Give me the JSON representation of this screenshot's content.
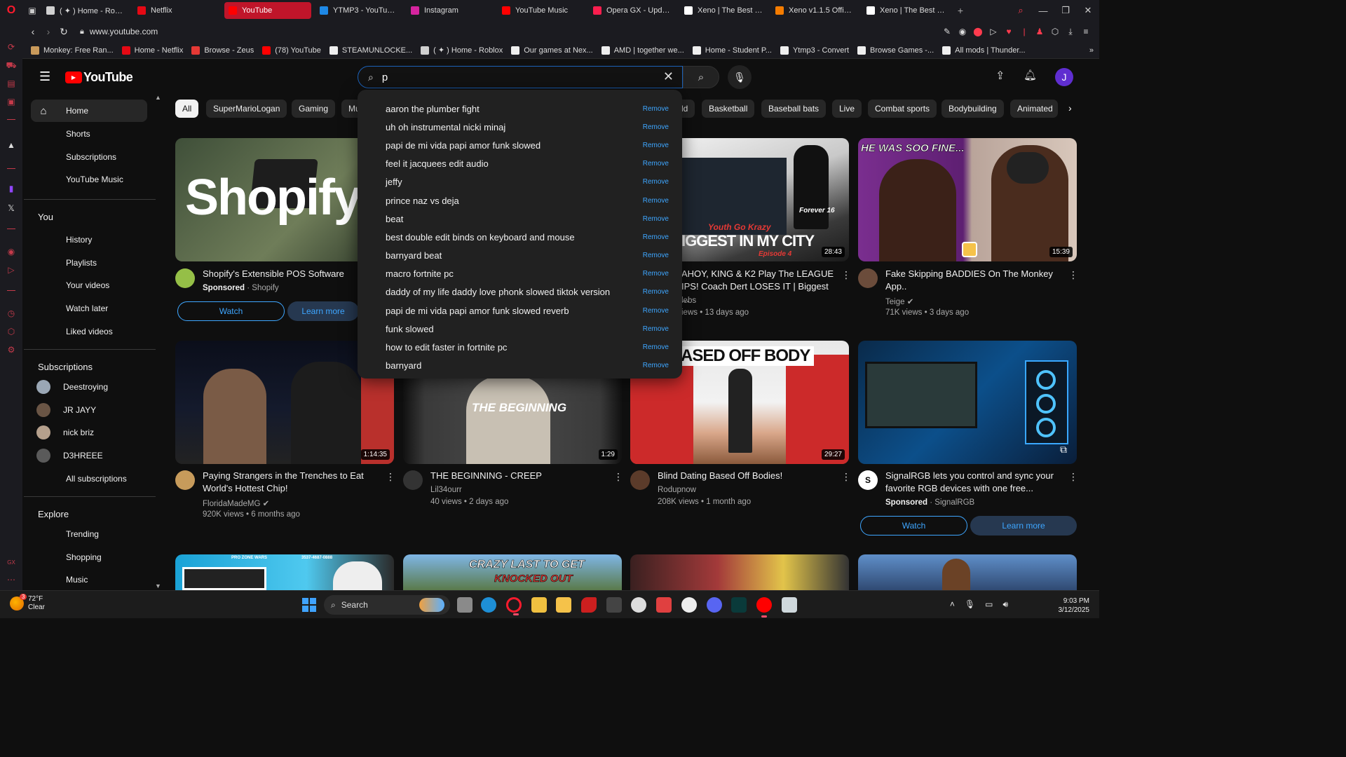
{
  "browser": {
    "tabs": [
      {
        "label": "( ✦ ) Home - Roblox",
        "color": "#d0d0d0",
        "active": false
      },
      {
        "label": "Netflix",
        "color": "#e50914",
        "active": false
      },
      {
        "label": "YouTube",
        "color": "#ff0000",
        "active": true
      },
      {
        "label": "YTMP3 - YouTube to",
        "color": "#1e88e5",
        "active": false
      },
      {
        "label": "Instagram",
        "color": "#d6249f",
        "active": false
      },
      {
        "label": "YouTube Music",
        "color": "#ff0000",
        "active": false
      },
      {
        "label": "Opera GX - Update c",
        "color": "#fa1e4e",
        "active": false
      },
      {
        "label": "Xeno | The Best Scri",
        "color": "#ffffff",
        "active": false
      },
      {
        "label": "Xeno v1.1.5 Official D",
        "color": "#f57c00",
        "active": false
      },
      {
        "label": "Xeno | The Best Scri",
        "color": "#ffffff",
        "active": false
      }
    ],
    "new_tab": "+",
    "url": "www.youtube.com",
    "bookmarks": [
      {
        "label": "Monkey: Free Ran...",
        "color": "#c99a5b"
      },
      {
        "label": "Home - Netflix",
        "color": "#e50914"
      },
      {
        "label": "Browse - Zeus",
        "color": "#e53935"
      },
      {
        "label": "(78) YouTube",
        "color": "#ff0000"
      },
      {
        "label": "STEAMUNLOCKE...",
        "color": "#eeeeee"
      },
      {
        "label": "( ✦ ) Home - Roblox",
        "color": "#d0d0d0"
      },
      {
        "label": "Our games at Nex...",
        "color": "#eeeeee"
      },
      {
        "label": "AMD | together we...",
        "color": "#eeeeee"
      },
      {
        "label": "Home - Student P...",
        "color": "#eeeeee"
      },
      {
        "label": "Ytmp3 - Convert",
        "color": "#eeeeee"
      },
      {
        "label": "Browse Games -...",
        "color": "#eeeeee"
      },
      {
        "label": "All mods | Thunder...",
        "color": "#eeeeee"
      }
    ],
    "bookmarks_more": "»"
  },
  "youtube": {
    "logo_text": "YouTube",
    "search": {
      "value": "p"
    },
    "avatar_letter": "J",
    "guide": {
      "main": [
        "Home",
        "Shorts",
        "Subscriptions",
        "YouTube Music"
      ],
      "you_title": "You",
      "you": [
        "History",
        "Playlists",
        "Your videos",
        "Watch later",
        "Liked videos"
      ],
      "subs_title": "Subscriptions",
      "subs": [
        "Deestroying",
        "JR JAYY",
        "nick briz",
        "D3HREEE"
      ],
      "all_subs": "All subscriptions",
      "explore_title": "Explore",
      "explore": [
        "Trending",
        "Shopping",
        "Music"
      ]
    },
    "chips": [
      "All",
      "SuperMarioLogan",
      "Gaming",
      "Mu",
      "ld",
      "Basketball",
      "Baseball bats",
      "Live",
      "Combat sports",
      "Bodybuilding",
      "Animated"
    ],
    "suggestions": [
      "aaron the plumber fight",
      "uh oh instrumental nicki minaj",
      "papi de mi vida papi amor funk slowed",
      "feel it jacquees edit audio",
      "jeffy",
      "prince naz vs deja",
      "beat",
      "best double edit binds on keyboard and mouse",
      "barnyard beat",
      "macro fortnite pc",
      "daddy of my life daddy love phonk slowed tiktok version",
      "papi de mi vida papi amor funk slowed reverb",
      "funk slowed",
      "how to edit faster in fortnite pc",
      "barnyard"
    ],
    "remove_label": "Remove",
    "videos": {
      "shopify": {
        "thumb_text": "Shopify",
        "title": "Shopify's Extensible POS Software",
        "sponsored": "Sponsored",
        "channel": "Shopify",
        "watch": "Watch",
        "learn": "Learn more"
      },
      "league": {
        "thumb_text1": "Youth Go Krazy",
        "thumb_text2": "IGGEST IN MY CITY",
        "thumb_text3": "Episode 4",
        "thumb_text4": "Forever 16",
        "duration": "28:43",
        "title": "AHOY, KING & K2 Play The LEAGUE IPS! Coach Dert LOSES IT | Biggest ...",
        "channel": "lebs",
        "meta": "iews • 13 days ago"
      },
      "teige": {
        "thumb_text": "HE WAS SOO FINE...",
        "duration": "15:39",
        "title": "Fake Skipping BADDIES On The Monkey App..",
        "channel": "Teige",
        "meta": "71K views • 3 days ago"
      },
      "strangers": {
        "duration": "1:14:35",
        "title": "Paying Strangers in the Trenches to Eat World's Hottest Chip!",
        "channel": "FloridaMadeMG",
        "meta": "920K views • 6 months ago"
      },
      "creep": {
        "thumb_text": "THE BEGINNING",
        "duration": "1:29",
        "title": "THE BEGINNING - CREEP",
        "channel": "Lil34ourr",
        "meta": "40 views • 2 days ago"
      },
      "blind": {
        "thumb_text": "ASED OFF BODY",
        "duration": "29:27",
        "title": "Blind Dating Based Off Bodies!",
        "channel": "Rodupnow",
        "meta": "208K views • 1 month ago"
      },
      "signal": {
        "title": "SignalRGB lets you control and sync your favorite RGB devices with one free...",
        "sponsored": "Sponsored",
        "channel": "SignalRGB",
        "watch": "Watch",
        "learn": "Learn more"
      },
      "row3": {
        "t1a": "PRO ZONE WARS",
        "t1b": "3537-4687-0888",
        "t2": "CRAZY LAST TO GET",
        "t2b": "KNOCKED OUT"
      }
    }
  },
  "taskbar": {
    "temp": "72°F",
    "condition": "Clear",
    "weather_badge": "3",
    "search": "Search",
    "time": "9:03 PM",
    "date": "3/12/2025"
  }
}
